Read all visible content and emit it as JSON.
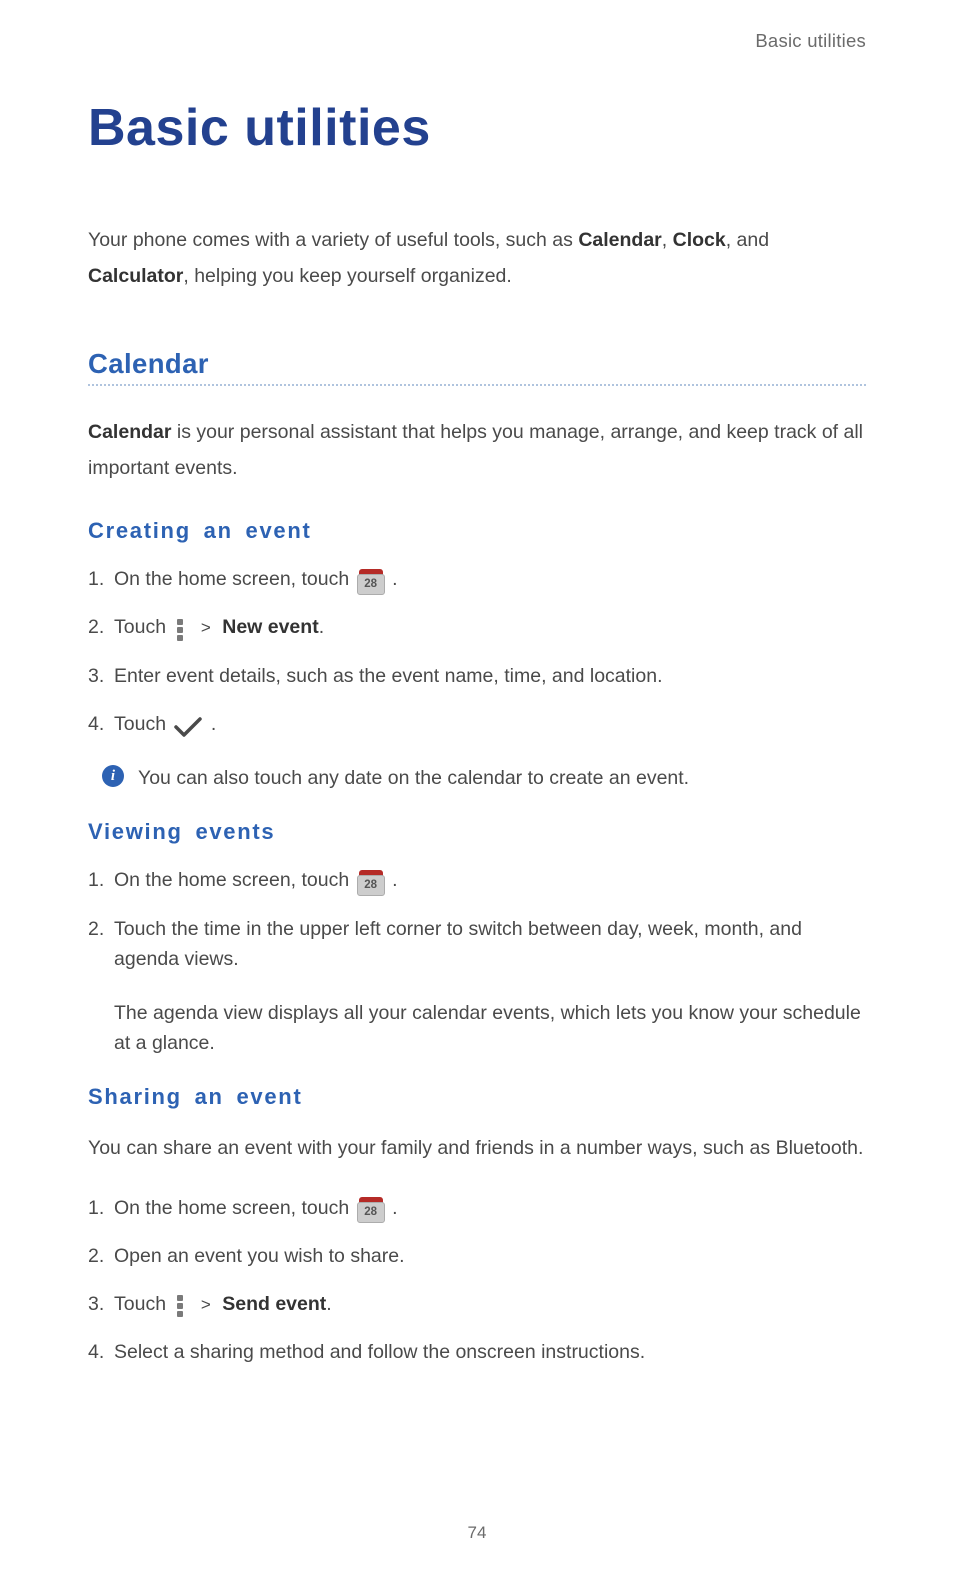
{
  "header": {
    "label": "Basic utilities"
  },
  "title": "Basic utilities",
  "intro": {
    "p1a": "Your phone comes with a variety of useful tools, such as ",
    "b1": "Calendar",
    "sep1": ", ",
    "b2": "Clock",
    "sep2": ", and ",
    "b3": "Calculator",
    "p1b": ", helping you keep yourself organized."
  },
  "calendar": {
    "title": "Calendar",
    "intro": {
      "b1": "Calendar",
      "rest": " is your personal assistant that helps you manage, arrange, and keep track of all important events."
    },
    "creating": {
      "heading": "Creating an event",
      "step1": {
        "num": "1.",
        "a": "On the home screen, touch ",
        "icon_day": "28",
        "b": " ."
      },
      "step2": {
        "num": "2.",
        "a": "Touch ",
        "gt": ">",
        "bold": "New event",
        "end": "."
      },
      "step3": {
        "num": "3.",
        "text": "Enter event details, such as the event name, time, and location."
      },
      "step4": {
        "num": "4.",
        "a": "Touch ",
        "b": " ."
      },
      "note": "You can also touch any date on the calendar to create an event."
    },
    "viewing": {
      "heading": "Viewing events",
      "step1": {
        "num": "1.",
        "a": "On the home screen, touch ",
        "icon_day": "28",
        "b": " ."
      },
      "step2": {
        "num": "2.",
        "text": "Touch the time in the upper left corner to switch between day, week, month, and agenda views."
      },
      "agenda_note": "The agenda view displays all your calendar events, which lets you know your schedule at a glance."
    },
    "sharing": {
      "heading": "Sharing an event",
      "intro": "You can share an event with your family and friends in a number ways, such as Bluetooth.",
      "step1": {
        "num": "1.",
        "a": "On the home screen, touch ",
        "icon_day": "28",
        "b": " ."
      },
      "step2": {
        "num": "2.",
        "text": "Open an event you wish to share."
      },
      "step3": {
        "num": "3.",
        "a": "Touch ",
        "gt": ">",
        "bold": "Send event",
        "end": "."
      },
      "step4": {
        "num": "4.",
        "text": "Select a sharing method and follow the onscreen instructions."
      }
    }
  },
  "page_number": "74"
}
